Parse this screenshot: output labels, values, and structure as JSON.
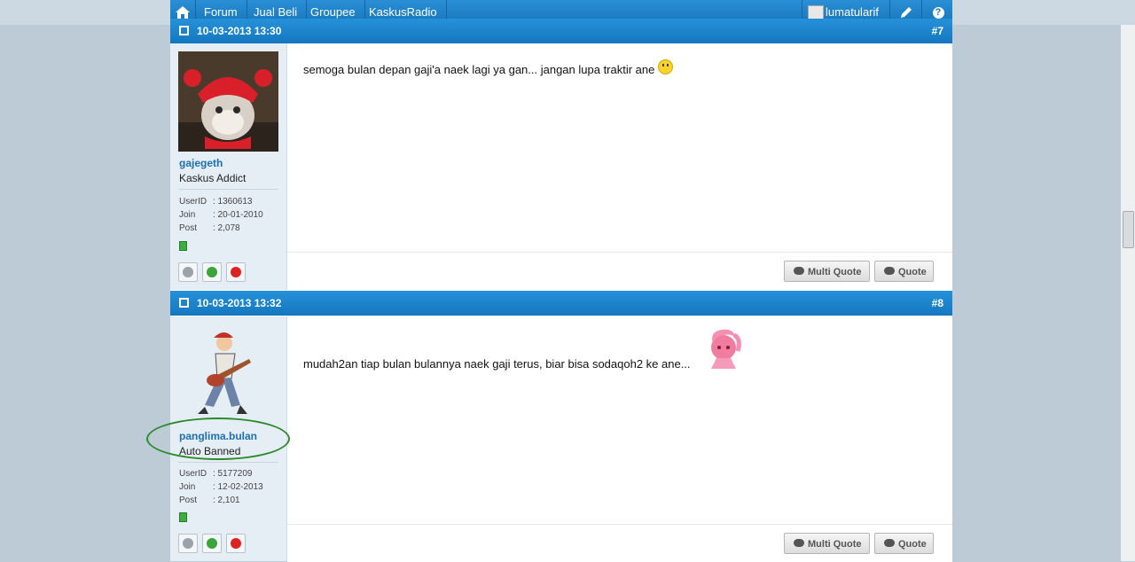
{
  "nav": {
    "links": [
      "Forum",
      "Jual Beli",
      "Groupee",
      "KaskusRadio"
    ],
    "username": "lumatularif"
  },
  "posts": [
    {
      "date": "10-03-2013 13:30",
      "number": "#7",
      "user": {
        "name": "gajegeth",
        "title": "Kaskus Addict",
        "stats": [
          {
            "label": "UserID",
            "value": ": 1360613"
          },
          {
            "label": "Join",
            "value": ": 20-01-2010"
          },
          {
            "label": "Post",
            "value": ": 2,078"
          }
        ]
      },
      "message": "semoga bulan depan gaji'a naek lagi ya gan... jangan lupa traktir ane",
      "buttons": {
        "multi_quote": "Multi Quote",
        "quote": "Quote"
      }
    },
    {
      "date": "10-03-2013 13:32",
      "number": "#8",
      "user": {
        "name": "panglima.bulan",
        "title": "Auto Banned",
        "stats": [
          {
            "label": "UserID",
            "value": ": 5177209"
          },
          {
            "label": "Join",
            "value": ": 12-02-2013"
          },
          {
            "label": "Post",
            "value": ": 2,101"
          }
        ]
      },
      "message": "mudah2an tiap bulan bulannya naek gaji terus, biar bisa sodaqoh2 ke ane...",
      "buttons": {
        "multi_quote": "Multi Quote",
        "quote": "Quote"
      }
    }
  ]
}
